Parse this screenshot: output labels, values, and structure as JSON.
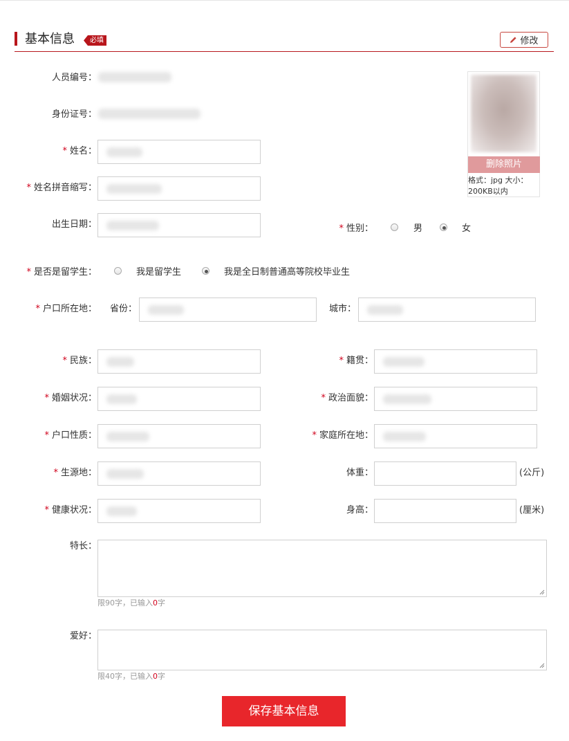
{
  "section": {
    "title": "基本信息",
    "required_tag": "必填",
    "edit_label": "修改"
  },
  "colors": {
    "accent": "#b8161c",
    "save": "#e8262b",
    "required_star": "#d0021b",
    "delete_photo": "#e09a9c"
  },
  "fields": {
    "person_id": {
      "label": "人员编号：",
      "value": ""
    },
    "id_card": {
      "label": "身份证号：",
      "value": ""
    },
    "name": {
      "star": "*",
      "label": "姓名：",
      "value": ""
    },
    "name_pinyin": {
      "star": "*",
      "label": "姓名拼音缩写：",
      "value": ""
    },
    "birthdate": {
      "label": "出生日期：",
      "value": ""
    },
    "gender": {
      "star": "*",
      "label": "性别：",
      "options": [
        "男",
        "女"
      ],
      "selected": "女"
    },
    "overseas": {
      "star": "*",
      "label": "是否是留学生：",
      "options": [
        "我是留学生",
        "我是全日制普通高等院校毕业生"
      ],
      "selected": "我是全日制普通高等院校毕业生"
    },
    "hukou_location": {
      "star": "*",
      "label": "户口所在地：",
      "province_label": "省份：",
      "province_value": "",
      "city_label": "城市：",
      "city_value": ""
    },
    "ethnicity": {
      "star": "*",
      "label": "民族：",
      "value": ""
    },
    "native_place": {
      "star": "*",
      "label": "籍贯：",
      "value": ""
    },
    "marital": {
      "star": "*",
      "label": "婚姻状况：",
      "value": ""
    },
    "political": {
      "star": "*",
      "label": "政治面貌：",
      "value": ""
    },
    "hukou_type": {
      "star": "*",
      "label": "户口性质：",
      "value": ""
    },
    "home_location": {
      "star": "*",
      "label": "家庭所在地：",
      "value": ""
    },
    "origin": {
      "star": "*",
      "label": "生源地：",
      "value": ""
    },
    "weight": {
      "label": "体重：",
      "value": "",
      "unit": "(公斤)"
    },
    "health": {
      "star": "*",
      "label": "健康状况：",
      "value": ""
    },
    "height": {
      "label": "身高：",
      "value": "",
      "unit": "(厘米)"
    },
    "specialty": {
      "label": "特长：",
      "value": "",
      "hint_prefix": "限90字，已输入",
      "count": "0",
      "hint_suffix": "字"
    },
    "hobby": {
      "label": "爱好：",
      "value": "",
      "hint_prefix": "限40字，已输入",
      "count": "0",
      "hint_suffix": "字"
    }
  },
  "photo": {
    "delete_label": "删除照片",
    "note": "格式：jpg 大小：200KB以内"
  },
  "save_label": "保存基本信息"
}
